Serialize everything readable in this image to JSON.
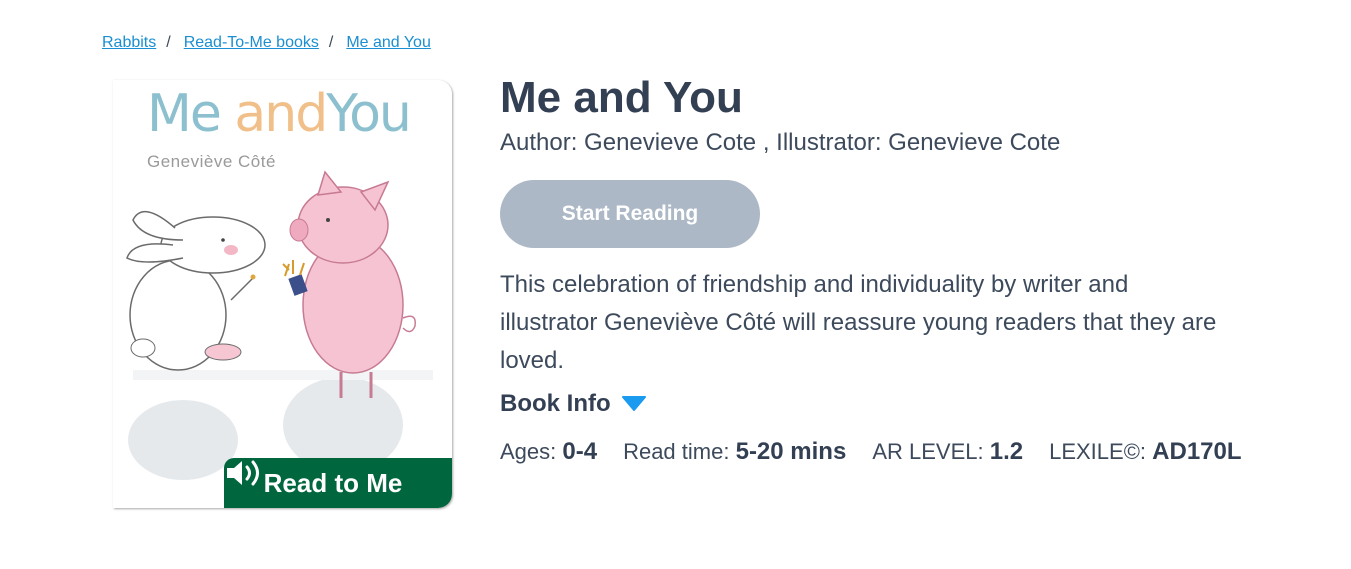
{
  "breadcrumb": {
    "items": [
      "Rabbits",
      "Read-To-Me books",
      "Me and You"
    ],
    "separator": "/"
  },
  "cover": {
    "title_part1": "Me ",
    "title_part2": "and",
    "title_part3": "You",
    "author": "Geneviève Côté",
    "badge_label": "Read to Me",
    "badge_icon": "speaker-icon",
    "badge_color": "#00663e"
  },
  "book": {
    "title": "Me and You",
    "byline": "Author: Genevieve Cote , Illustrator: Genevieve Cote",
    "start_label": "Start Reading",
    "description": "This celebration of friendship and individuality by writer and illustrator Geneviève Côté will reassure young readers that they are loved.",
    "book_info_label": "Book Info",
    "book_info_icon": "triangle-down-icon"
  },
  "meta": {
    "ages_label": "Ages:",
    "ages_value": "0-4",
    "readtime_label": "Read time:",
    "readtime_value": "5-20 mins",
    "ar_label": "AR LEVEL:",
    "ar_value": "1.2",
    "lexile_label": "LEXILE©:",
    "lexile_value": "AD170L"
  },
  "colors": {
    "link": "#1a8fd1",
    "button_disabled": "#adb8c6",
    "text": "#3d4a5c",
    "triangle": "#1a9bf0"
  }
}
